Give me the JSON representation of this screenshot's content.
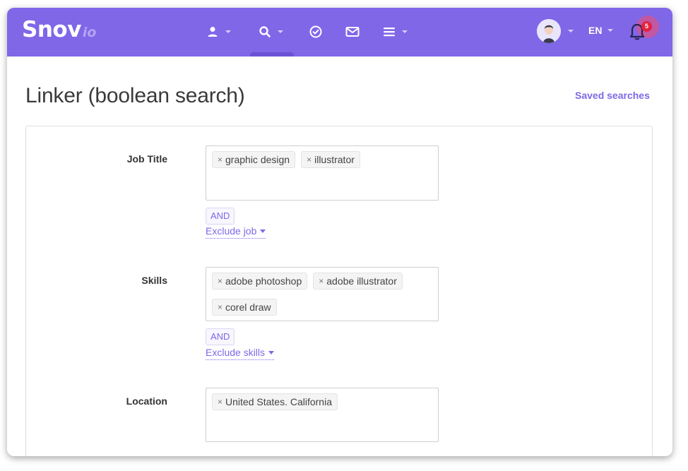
{
  "app": {
    "logo_main": "Snov",
    "logo_suffix": "io"
  },
  "nav": {
    "items": [
      {
        "icon": "person-icon",
        "has_caret": true
      },
      {
        "icon": "search-icon",
        "has_caret": true,
        "active": true
      },
      {
        "icon": "check-circle-icon",
        "has_caret": false
      },
      {
        "icon": "mail-icon",
        "has_caret": false
      },
      {
        "icon": "menu-icon",
        "has_caret": true
      }
    ],
    "language": "EN",
    "notifications_count": "5"
  },
  "page": {
    "title": "Linker (boolean search)",
    "saved_searches_label": "Saved searches"
  },
  "form": {
    "job_title": {
      "label": "Job Title",
      "tags": [
        "graphic design",
        "illustrator"
      ],
      "operator": "AND",
      "exclude_label": "Exclude job"
    },
    "skills": {
      "label": "Skills",
      "tags": [
        "adobe photoshop",
        "adobe illustrator",
        "corel draw"
      ],
      "operator": "AND",
      "exclude_label": "Exclude skills"
    },
    "location": {
      "label": "Location",
      "tags": [
        "United States. California"
      ]
    }
  },
  "colors": {
    "brand": "#7f67e8",
    "badge": "#e5213f",
    "text": "#333333"
  }
}
